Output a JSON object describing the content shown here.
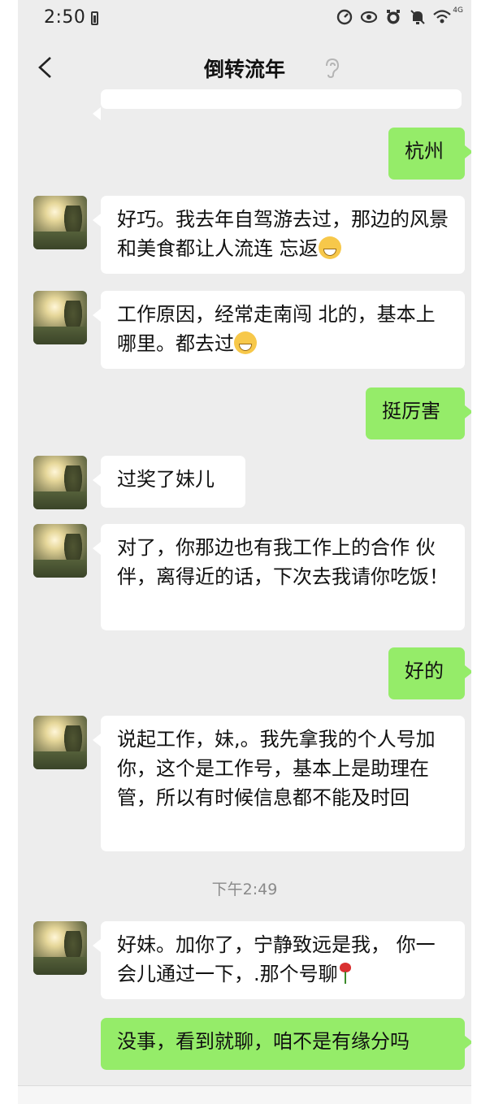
{
  "status_bar": {
    "time": "2:50",
    "network": "4G"
  },
  "header": {
    "title": "倒转流年"
  },
  "messages": [
    {
      "text": "杭州"
    },
    {
      "text": "好巧。我去年自驾游去过，那边的风景和美食都让人流连  忘返"
    },
    {
      "text": "工作原因，经常走南闯 北的，基本上哪里。都去过"
    },
    {
      "text": "挺厉害"
    },
    {
      "text": "过奖了妹儿"
    },
    {
      "text": "对了，你那边也有我工作上的合作  伙伴，离得近的话，下次去我请你吃饭！"
    },
    {
      "text": "好的"
    },
    {
      "text": "说起工作，妹,。我先拿我的个人号加你，这个是工作号，基本上是助理在管，所以有时候信息都不能及时回"
    },
    {
      "timestamp": "下午2:49"
    },
    {
      "text": "好妹。加你了，宁静致远是我，  你一会儿通过一下，.那个号聊"
    },
    {
      "text": "没事，看到就聊，咱不是有缘分吗"
    }
  ],
  "icons": [
    "back-icon",
    "voice-ear-icon",
    "avatar",
    "grin-emoji-icon",
    "rose-emoji-icon",
    "battery-icon",
    "wifi-icon",
    "eye-icon",
    "alarm-icon",
    "mute-icon"
  ],
  "colors": {
    "background": "#ededed",
    "outgoing_bubble": "#95ec69",
    "incoming_bubble": "#ffffff",
    "timestamp": "#8a8a8a"
  }
}
